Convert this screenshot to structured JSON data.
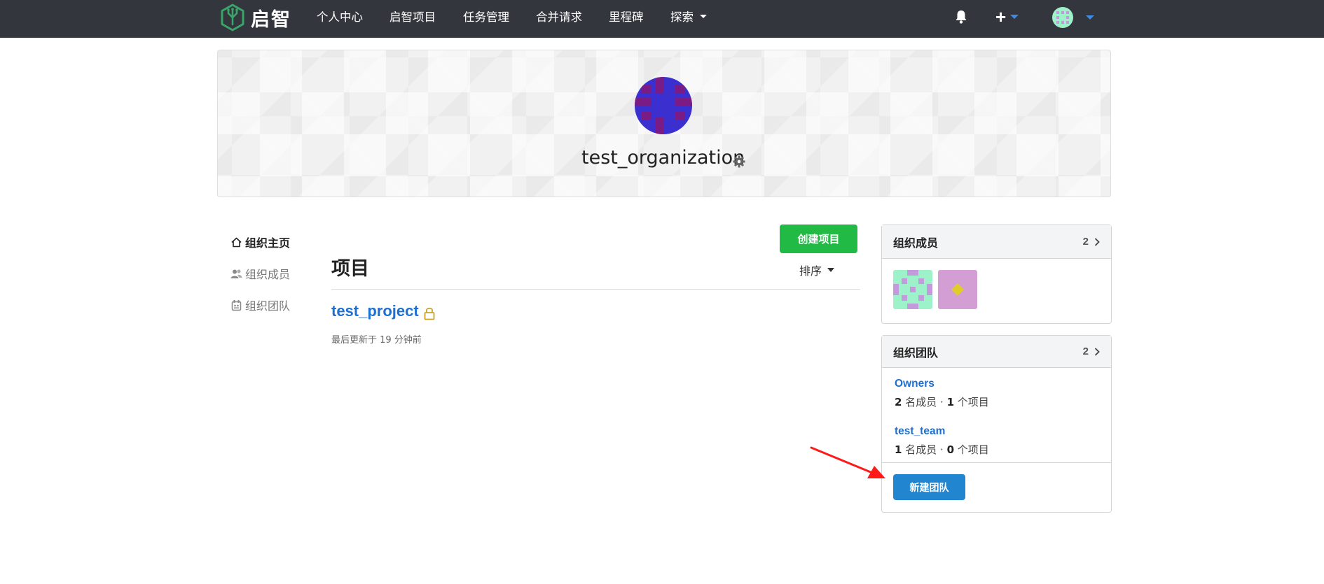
{
  "app": {
    "logo_text": "启智"
  },
  "nav": {
    "items": [
      {
        "label": "个人中心"
      },
      {
        "label": "启智项目"
      },
      {
        "label": "任务管理"
      },
      {
        "label": "合并请求"
      },
      {
        "label": "里程碑"
      },
      {
        "label": "探索"
      }
    ],
    "icons": [
      "bell-icon",
      "plus-icon",
      "user-avatar"
    ]
  },
  "header": {
    "org_name": "test_organization"
  },
  "sidebar": {
    "items": [
      {
        "label": "组织主页",
        "icon": "home-icon",
        "active": true
      },
      {
        "label": "组织成员",
        "icon": "users-icon",
        "active": false
      },
      {
        "label": "组织团队",
        "icon": "team-icon",
        "active": false
      }
    ]
  },
  "main": {
    "create_button": "创建项目",
    "title": "项目",
    "sort_label": "排序",
    "projects": [
      {
        "name": "test_project",
        "private": true,
        "updated": "最后更新于 19 分钟前"
      }
    ]
  },
  "members_card": {
    "title": "组织成员",
    "count": "2"
  },
  "teams_card": {
    "title": "组织团队",
    "count": "2",
    "teams": [
      {
        "name": "Owners",
        "members": "2",
        "members_unit": "名成员",
        "sep": "·",
        "repos": "1",
        "repos_unit": "个项目"
      },
      {
        "name": "test_team",
        "members": "1",
        "members_unit": "名成员",
        "sep": "·",
        "repos": "0",
        "repos_unit": "个项目"
      }
    ],
    "new_team_button": "新建团队"
  },
  "colors": {
    "nav_bg": "#33363d",
    "green": "#21ba45",
    "blue": "#2185d0",
    "link": "#1d6fd0",
    "annotation_arrow": "#ff1a1a"
  }
}
